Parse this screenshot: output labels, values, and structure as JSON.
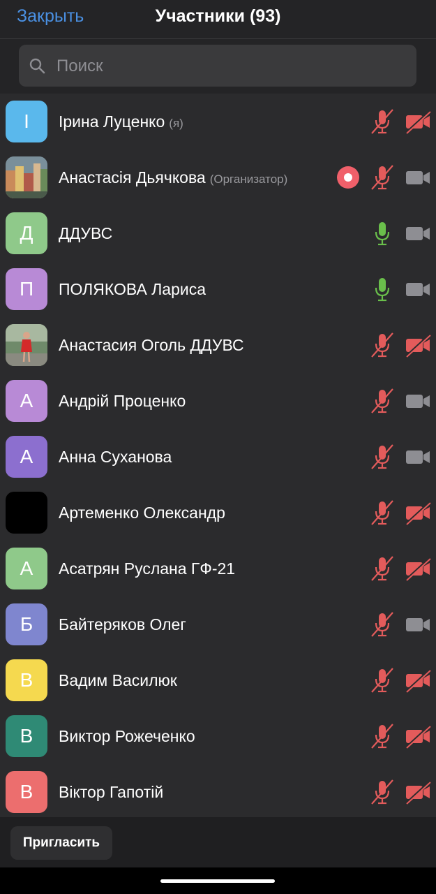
{
  "header": {
    "close_label": "Закрыть",
    "title": "Участники (93)"
  },
  "search": {
    "placeholder": "Поиск",
    "icon": "search-icon"
  },
  "colors": {
    "accent": "#4a90e2",
    "mic_muted": "#e35b5b",
    "mic_active": "#6abf4b",
    "cam_off": "#e35b5b",
    "cam_on": "#8e8e93",
    "record": "#f0606a"
  },
  "participants": [
    {
      "initial": "І",
      "name": "Ірина Луценко",
      "role": "(я)",
      "avatar_color": "#5ab8ec",
      "avatar_type": "letter",
      "mic": "muted",
      "cam": "off",
      "recording": false
    },
    {
      "initial": "",
      "name": "Анастасія Дьячкова",
      "role": "(Организатор)",
      "avatar_color": "#6a7a80",
      "avatar_type": "photo-city",
      "mic": "muted",
      "cam": "on",
      "recording": true
    },
    {
      "initial": "Д",
      "name": "ДДУВС",
      "role": "",
      "avatar_color": "#8fc98a",
      "avatar_type": "letter",
      "mic": "active",
      "cam": "on",
      "recording": false
    },
    {
      "initial": "П",
      "name": "ПОЛЯКОВА Лариса",
      "role": "",
      "avatar_color": "#b88ad6",
      "avatar_type": "letter",
      "mic": "active",
      "cam": "on",
      "recording": false
    },
    {
      "initial": "",
      "name": "Анастасия Оголь ДДУВС",
      "role": "",
      "avatar_color": "#8a9a7a",
      "avatar_type": "photo-person",
      "mic": "muted",
      "cam": "off",
      "recording": false
    },
    {
      "initial": "А",
      "name": "Андрій Проценко",
      "role": "",
      "avatar_color": "#b88ad6",
      "avatar_type": "letter",
      "mic": "muted",
      "cam": "on",
      "recording": false
    },
    {
      "initial": "А",
      "name": "Анна Суханова",
      "role": "",
      "avatar_color": "#8c6fcf",
      "avatar_type": "letter",
      "mic": "muted",
      "cam": "on",
      "recording": false
    },
    {
      "initial": "",
      "name": "Артеменко Олександр",
      "role": "",
      "avatar_color": "#000000",
      "avatar_type": "letter",
      "mic": "muted",
      "cam": "off",
      "recording": false
    },
    {
      "initial": "А",
      "name": "Асатрян Руслана ГФ-21",
      "role": "",
      "avatar_color": "#8fc98a",
      "avatar_type": "letter",
      "mic": "muted",
      "cam": "off",
      "recording": false
    },
    {
      "initial": "Б",
      "name": "Байтеряков Олег",
      "role": "",
      "avatar_color": "#7f86cf",
      "avatar_type": "letter",
      "mic": "muted",
      "cam": "on",
      "recording": false
    },
    {
      "initial": "В",
      "name": "Вадим Василюк",
      "role": "",
      "avatar_color": "#f5d94f",
      "avatar_type": "letter",
      "mic": "muted",
      "cam": "off",
      "recording": false
    },
    {
      "initial": "В",
      "name": "Виктор Рожеченко",
      "role": "",
      "avatar_color": "#2f8a75",
      "avatar_type": "letter",
      "mic": "muted",
      "cam": "off",
      "recording": false
    },
    {
      "initial": "В",
      "name": "Віктор Гапотій",
      "role": "",
      "avatar_color": "#ec6e6e",
      "avatar_type": "letter",
      "mic": "muted",
      "cam": "off",
      "recording": false
    }
  ],
  "footer": {
    "invite_label": "Пригласить"
  }
}
